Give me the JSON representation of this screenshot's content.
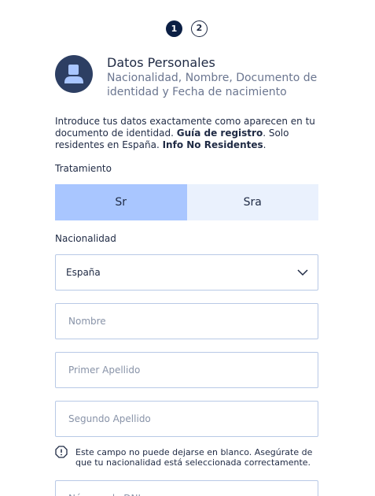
{
  "steps": {
    "current": "1",
    "next": "2"
  },
  "header": {
    "title": "Datos Personales",
    "subtitle": "Nacionalidad, Nombre, Documento de identidad y Fecha de nacimiento"
  },
  "intro": {
    "text_before": "Introduce tus datos exactamente como aparecen en tu documento de identidad. ",
    "guide_link": "Guía de registro",
    "text_middle": ". Solo residentes en España. ",
    "non_residents_link": "Info No Residentes",
    "text_after": "."
  },
  "title_field": {
    "label": "Tratamiento",
    "options": [
      "Sr",
      "Sra"
    ],
    "selected": "Sr"
  },
  "nationality": {
    "label": "Nacionalidad",
    "value": "España"
  },
  "fields": {
    "first_name_placeholder": "Nombre",
    "first_surname_placeholder": "Primer Apellido",
    "second_surname_placeholder": "Segundo Apellido",
    "document_placeholder": "Número de DNI"
  },
  "error": {
    "message": "Este campo no puede dejarse en blanco. Asegúrate de que tu nacionalidad está seleccionada correctamente."
  },
  "colors": {
    "navy": "#0b1f44",
    "selected_toggle": "#a9c6ff",
    "unselected_toggle": "#eaf1fd",
    "field_border": "#b8c9e6"
  },
  "icons": {
    "avatar": "user-avatar-icon",
    "dropdown": "chevron-down-icon",
    "error": "warning-icon"
  }
}
